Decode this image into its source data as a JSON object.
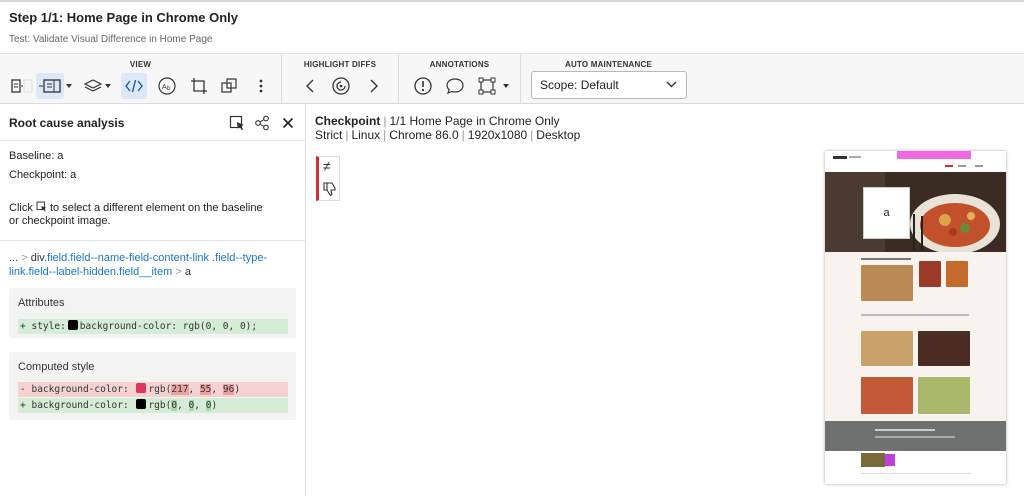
{
  "header": {
    "step_title": "Step 1/1: Home Page in Chrome Only",
    "test_name": "Test: Validate Visual Difference in Home Page"
  },
  "toolbar": {
    "groups": {
      "view": "VIEW",
      "highlight": "HIGHLIGHT DIFFS",
      "annotations": "ANNOTATIONS",
      "auto": "AUTO MAINTENANCE"
    },
    "scope_select": "Scope: Default"
  },
  "panel": {
    "title": "Root cause analysis",
    "baseline": "Baseline: a",
    "checkpoint": "Checkpoint: a",
    "hint_prefix": "Click",
    "hint_suffix": "to select a different element on the baseline",
    "hint_line2": "or checkpoint image.",
    "path": {
      "ellipsis": "...",
      "separator": ">",
      "tag": "div",
      "classes": ".field.field--name-field-content-link .field--type-link.field--label-hidden.field__item",
      "leaf": "a"
    },
    "attributes": {
      "title": "Attributes",
      "line_sign": "+",
      "line_prop": "style:",
      "line_value": "background-color: rgb(0, 0, 0);"
    },
    "computed": {
      "title": "Computed style",
      "removed": {
        "sign": "-",
        "prop": "background-color:",
        "prefix": "rgb(",
        "r": "217",
        "sep1": ", ",
        "g": "55",
        "sep2": ", ",
        "b": "96",
        "suffix": ")",
        "color": "#d93760"
      },
      "added": {
        "sign": "+",
        "prop": "background-color:",
        "prefix": "rgb(",
        "r": "0",
        "sep1": ", ",
        "g": "0",
        "sep2": ", ",
        "b": "0",
        "suffix": ")",
        "color": "#000000"
      }
    }
  },
  "main": {
    "checkpoint_label": "Checkpoint",
    "checkpoint_name": "1/1 Home Page in Chrome Only",
    "meta": [
      "Strict",
      "Linux",
      "Chrome 86.0",
      "1920x1080",
      "Desktop"
    ],
    "diff_symbol": "≠",
    "preview_box_text": "a"
  },
  "colors": {
    "accent_red": "#d32f2f",
    "link_blue": "#1a73c8",
    "highlight_pink": "#f06adf",
    "footer_grey": "#6f7170"
  }
}
